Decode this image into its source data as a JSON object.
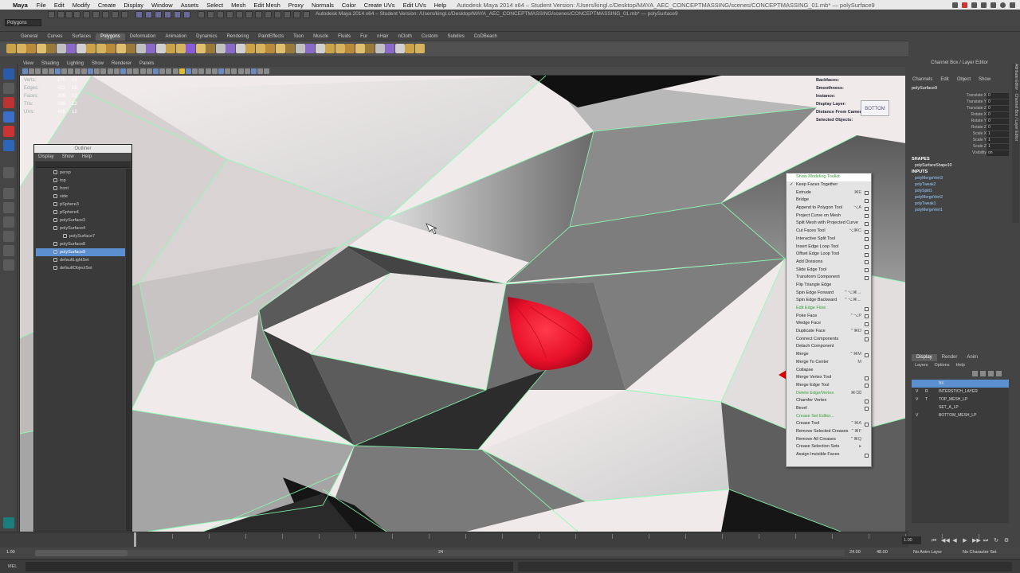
{
  "menubar": {
    "apple": "",
    "app": "Maya",
    "items": [
      "File",
      "Edit",
      "Modify",
      "Create",
      "Display",
      "Window",
      "Assets",
      "Select",
      "Mesh",
      "Edit Mesh",
      "Proxy",
      "Normals",
      "Color",
      "Create UVs",
      "Edit UVs",
      "Help"
    ],
    "window_title": "Autodesk Maya 2014 x64 – Student Version: /Users/kingl.c/Desktop/MAYA_AEC_CONCEPTMASSING/scenes/CONCEPTMASSING_01.mb* — polySurface9"
  },
  "statusline": {
    "mode": "Polygons"
  },
  "shelf": {
    "tabs": [
      "General",
      "Curves",
      "Surfaces",
      "Polygons",
      "Deformation",
      "Animation",
      "Dynamics",
      "Rendering",
      "PaintEffects",
      "Toon",
      "Muscle",
      "Fluids",
      "Fur",
      "nHair",
      "nCloth",
      "Custom",
      "Subdivs",
      "CoDBeach"
    ],
    "active_tab": "Polygons"
  },
  "viewport": {
    "menu": [
      "View",
      "Shading",
      "Lighting",
      "Show",
      "Renderer",
      "Panels"
    ],
    "hud_left": {
      "labels": [
        "Verts:",
        "Edges:",
        "Faces:",
        "Tris:",
        "UVs:"
      ],
      "values": [
        "270",
        "422",
        "205",
        "369",
        "465"
      ],
      "values2": [
        "14",
        "16",
        "12",
        "12",
        "12"
      ]
    },
    "hud_right": [
      "Backfaces:",
      "Smoothness:",
      "Instance:",
      "Display Layer:",
      "Distance From Camera:",
      "Selected Objects:"
    ],
    "viewcube": "BOTTOM"
  },
  "outliner": {
    "title": "Outliner",
    "menu": [
      "Display",
      "Show",
      "Help"
    ],
    "items": [
      {
        "label": "persp",
        "indent": 0,
        "selected": false
      },
      {
        "label": "top",
        "indent": 0,
        "selected": false
      },
      {
        "label": "front",
        "indent": 0,
        "selected": false
      },
      {
        "label": "side",
        "indent": 0,
        "selected": false
      },
      {
        "label": "pSphere3",
        "indent": 0,
        "selected": false
      },
      {
        "label": "pSphere4",
        "indent": 0,
        "selected": false
      },
      {
        "label": "polySurface3",
        "indent": 0,
        "selected": false
      },
      {
        "label": "polySurface4",
        "indent": 0,
        "selected": false
      },
      {
        "label": "polySurface7",
        "indent": 1,
        "selected": false
      },
      {
        "label": "polySurface8",
        "indent": 0,
        "selected": false
      },
      {
        "label": "polySurface9",
        "indent": 0,
        "selected": true
      },
      {
        "label": "defaultLightSet",
        "indent": 0,
        "selected": false
      },
      {
        "label": "defaultObjectSet",
        "indent": 0,
        "selected": false
      }
    ]
  },
  "context_menu": {
    "items": [
      {
        "label": "Show Modeling Toolkit",
        "sc": "",
        "box": false,
        "style": "hl",
        "check": ""
      },
      {
        "label": "Keep Faces Together",
        "sc": "",
        "box": false,
        "style": "",
        "check": "✓"
      },
      {
        "label": "Extrude",
        "sc": "⌘E",
        "box": true,
        "style": "",
        "check": ""
      },
      {
        "label": "Bridge",
        "sc": "",
        "box": true,
        "style": "",
        "check": ""
      },
      {
        "label": "Append to Polygon Tool",
        "sc": "⌥A",
        "box": true,
        "style": "",
        "check": ""
      },
      {
        "label": "Project Curve on Mesh",
        "sc": "",
        "box": true,
        "style": "",
        "check": ""
      },
      {
        "label": "Split Mesh with Projected Curve",
        "sc": "",
        "box": true,
        "style": "",
        "check": ""
      },
      {
        "label": "Cut Faces Tool",
        "sc": "⌥⌘C",
        "box": true,
        "style": "",
        "check": ""
      },
      {
        "label": "Interactive Split Tool",
        "sc": "",
        "box": true,
        "style": "",
        "check": ""
      },
      {
        "label": "Insert Edge Loop Tool",
        "sc": "",
        "box": true,
        "style": "",
        "check": ""
      },
      {
        "label": "Offset Edge Loop Tool",
        "sc": "",
        "box": true,
        "style": "",
        "check": ""
      },
      {
        "label": "Add Divisions",
        "sc": "",
        "box": true,
        "style": "",
        "check": ""
      },
      {
        "label": "Slide Edge Tool",
        "sc": "",
        "box": true,
        "style": "",
        "check": ""
      },
      {
        "label": "Transform Component",
        "sc": "",
        "box": true,
        "style": "",
        "check": ""
      },
      {
        "label": "Flip Triangle Edge",
        "sc": "",
        "box": false,
        "style": "",
        "check": ""
      },
      {
        "label": "Spin Edge Forward",
        "sc": "⌃⌥⌘→",
        "box": false,
        "style": "",
        "check": ""
      },
      {
        "label": "Spin Edge Backward",
        "sc": "⌃⌥⌘←",
        "box": false,
        "style": "",
        "check": ""
      },
      {
        "label": "Edit Edge Flow",
        "sc": "",
        "box": true,
        "style": "hl",
        "check": ""
      },
      {
        "label": "Poke Face",
        "sc": "⌃⌥P",
        "box": true,
        "style": "",
        "check": ""
      },
      {
        "label": "Wedge Face",
        "sc": "",
        "box": true,
        "style": "",
        "check": ""
      },
      {
        "label": "Duplicate Face",
        "sc": "⌃⌘D",
        "box": true,
        "style": "",
        "check": ""
      },
      {
        "label": "Connect Components",
        "sc": "",
        "box": true,
        "style": "",
        "check": ""
      },
      {
        "label": "Detach Component",
        "sc": "",
        "box": false,
        "style": "",
        "check": ""
      },
      {
        "label": "Merge",
        "sc": "⌃⌘M",
        "box": true,
        "style": "",
        "check": ""
      },
      {
        "label": "Merge To Center",
        "sc": "M",
        "box": false,
        "style": "",
        "check": ""
      },
      {
        "label": "Collapse",
        "sc": "",
        "box": false,
        "style": "",
        "check": ""
      },
      {
        "label": "Merge Vertex Tool",
        "sc": "",
        "box": true,
        "style": "",
        "check": ""
      },
      {
        "label": "Merge Edge Tool",
        "sc": "",
        "box": true,
        "style": "",
        "check": ""
      },
      {
        "label": "Delete Edge/Vertex",
        "sc": "⌘⌫",
        "box": false,
        "style": "hl",
        "check": ""
      },
      {
        "label": "Chamfer Vertex",
        "sc": "",
        "box": true,
        "style": "",
        "check": ""
      },
      {
        "label": "Bevel",
        "sc": "",
        "box": true,
        "style": "",
        "check": ""
      },
      {
        "label": "Crease Set Editor...",
        "sc": "",
        "box": false,
        "style": "hl",
        "check": ""
      },
      {
        "label": "Crease Tool",
        "sc": "⌃⌘A",
        "box": true,
        "style": "",
        "check": ""
      },
      {
        "label": "Remove Selected Creases",
        "sc": "⌃⌘F",
        "box": false,
        "style": "",
        "check": ""
      },
      {
        "label": "Remove All Creases",
        "sc": "⌃⌘Q",
        "box": false,
        "style": "",
        "check": ""
      },
      {
        "label": "Crease Selection Sets",
        "sc": "▸",
        "box": false,
        "style": "",
        "check": ""
      },
      {
        "label": "Assign Invisible Faces",
        "sc": "",
        "box": true,
        "style": "",
        "check": ""
      }
    ]
  },
  "channel_box": {
    "title": "Channel Box / Layer Editor",
    "menu": [
      "Channels",
      "Edit",
      "Object",
      "Show"
    ],
    "object": "polySurface9",
    "channels": [
      "Translate X",
      "Translate Y",
      "Translate Z",
      "Rotate X",
      "Rotate Y",
      "Rotate Z",
      "Scale X",
      "Scale Y",
      "Scale Z",
      "Visibility"
    ],
    "values": [
      "0",
      "0",
      "0",
      "0",
      "0",
      "0",
      "1",
      "1",
      "1",
      "on"
    ],
    "shapes_header": "SHAPES",
    "shape": "polySurfaceShape10",
    "inputs_header": "INPUTS",
    "inputs": [
      "polyMergeVert3",
      "polyTweak2",
      "polySplit1",
      "polyMergeVert2",
      "polyTweak1",
      "polyMergeVert1"
    ]
  },
  "layer_editor": {
    "tabs": [
      "Display",
      "Render",
      "Anim"
    ],
    "active_tab": "Display",
    "menu": [
      "Layers",
      "Options",
      "Help"
    ],
    "layers": [
      {
        "v": "",
        "t": "",
        "name": "BK",
        "selected": true
      },
      {
        "v": "V",
        "t": "R",
        "name": "INTERSTICH_LAYER",
        "selected": false
      },
      {
        "v": "V",
        "t": "T",
        "name": "TOP_MESH_LP",
        "selected": false
      },
      {
        "v": "",
        "t": "",
        "name": "SET_A_LP",
        "selected": false
      },
      {
        "v": "V",
        "t": "",
        "name": "BOTTOM_MESH_LP",
        "selected": false
      }
    ],
    "side_tabs": "Attribute Editor · Channel Box / Layer Editor"
  },
  "time": {
    "start": "1.00",
    "end": "24",
    "current": "1.00",
    "range_start": "1.00",
    "range_end": "24.00",
    "anim_end": "48.00",
    "anim_layer": "No Anim Layer",
    "char_set": "No Character Set"
  },
  "cmdline": {
    "label": "MEL"
  },
  "colors": {
    "accent": "#5a8fd0",
    "wire": "#86ffb0",
    "menu_highlight": "#3a9f3a",
    "red_object": "#e8102a"
  }
}
